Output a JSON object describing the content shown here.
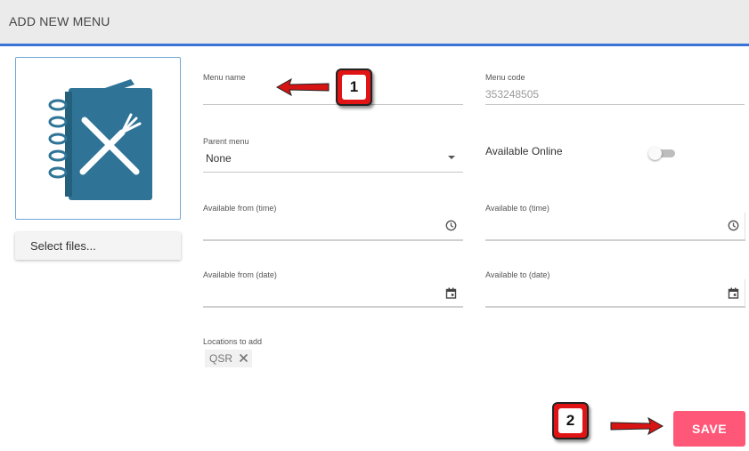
{
  "header": {
    "title": "ADD NEW MENU"
  },
  "image_upload": {
    "select_files_label": "Select files..."
  },
  "form": {
    "menu_name": {
      "label": "Menu name",
      "value": ""
    },
    "menu_code": {
      "label": "Menu code",
      "value": "353248505"
    },
    "parent_menu": {
      "label": "Parent menu",
      "value": "None"
    },
    "available_online": {
      "label": "Available Online",
      "enabled": false
    },
    "available_from_time": {
      "label": "Available from (time)",
      "value": ""
    },
    "available_to_time": {
      "label": "Available to (time)",
      "value": ""
    },
    "available_from_date": {
      "label": "Available from (date)",
      "value": ""
    },
    "available_to_date": {
      "label": "Available to (date)",
      "value": ""
    },
    "locations": {
      "label": "Locations to add",
      "chips": [
        "QSR"
      ]
    }
  },
  "actions": {
    "save_label": "SAVE"
  },
  "annotations": {
    "callout_1": "1",
    "callout_2": "2"
  },
  "colors": {
    "accent": "#3a73d6",
    "save_button": "#ff5778",
    "menu_icon": "#2f7496",
    "callout": "#e01414"
  },
  "icons": [
    "menu-book-icon",
    "clock-icon",
    "calendar-icon",
    "dropdown-caret-icon",
    "close-icon",
    "toggle-switch",
    "arrow-icon"
  ]
}
